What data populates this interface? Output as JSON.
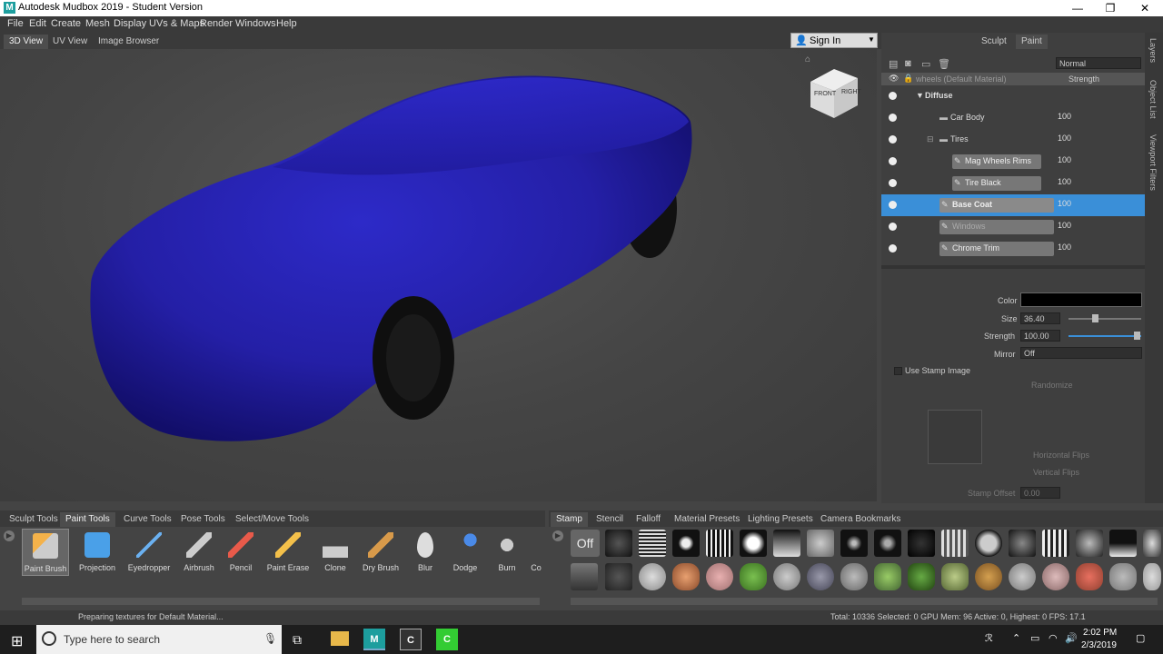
{
  "app": {
    "title": "Autodesk Mudbox 2019 - Student Version",
    "logo": "M",
    "minimize": "—",
    "maximize": "❐",
    "close": "✕"
  },
  "menu": [
    "File",
    "Edit",
    "Create",
    "Mesh",
    "Display",
    "UVs & Maps",
    "Render",
    "Windows",
    "Help"
  ],
  "view_tabs": [
    "3D View",
    "UV View",
    "Image Browser"
  ],
  "signin": {
    "label": "Sign In"
  },
  "viewcube": {
    "front": "FRONT",
    "right": "RIGHT"
  },
  "panel": {
    "tabs": [
      "Sculpt",
      "Paint"
    ],
    "blend_mode": "Normal",
    "material_header": "wheels (Default Material)",
    "strength_header": "Strength",
    "diffuse": "Diffuse",
    "layers": [
      {
        "name": "Car Body",
        "value": "100",
        "type": "folder"
      },
      {
        "name": "Tires",
        "value": "100",
        "type": "folder"
      },
      {
        "name": "Mag Wheels Rims",
        "value": "100",
        "type": "layer"
      },
      {
        "name": "Tire Black",
        "value": "100",
        "type": "layer"
      },
      {
        "name": "Base Coat",
        "value": "100",
        "type": "layer",
        "selected": true
      },
      {
        "name": "Windows",
        "value": "100",
        "type": "layer"
      },
      {
        "name": "Chrome Trim",
        "value": "100",
        "type": "layer"
      }
    ],
    "props": {
      "color_label": "Color",
      "size_label": "Size",
      "size_value": "36.40",
      "strength_label": "Strength",
      "strength_value": "100.00",
      "mirror_label": "Mirror",
      "mirror_value": "Off",
      "use_stamp_label": "Use Stamp Image",
      "randomize_label": "Randomize",
      "hflip_label": "Horizontal Flips",
      "vflip_label": "Vertical Flips",
      "stamp_offset_label": "Stamp Offset",
      "stamp_offset_value": "0.00"
    }
  },
  "side_tabs": [
    "Layers",
    "Object List",
    "Viewport Filters"
  ],
  "tool_tabs": [
    "Sculpt Tools",
    "Paint Tools",
    "Curve Tools",
    "Pose Tools",
    "Select/Move Tools"
  ],
  "tools": [
    "Paint Brush",
    "Projection",
    "Eyedropper",
    "Airbrush",
    "Pencil",
    "Paint Erase",
    "Clone",
    "Dry Brush",
    "Blur",
    "Dodge",
    "Burn",
    "Co"
  ],
  "stamp_tabs": [
    "Stamp",
    "Stencil",
    "Falloff",
    "Material Presets",
    "Lighting Presets",
    "Camera Bookmarks"
  ],
  "stamp_off": "Off",
  "status": {
    "left": "Preparing textures for Default Material...",
    "right": "Total: 10336  Selected: 0 GPU Mem: 96  Active: 0, Highest: 0  FPS: 17.1"
  },
  "taskbar": {
    "search_placeholder": "Type here to search",
    "time": "2:02 PM",
    "date": "2/3/2019"
  },
  "colors": {
    "car_body": "#2a24b8",
    "accent": "#3a8fd8",
    "selected_row": "#3a8fd8"
  }
}
